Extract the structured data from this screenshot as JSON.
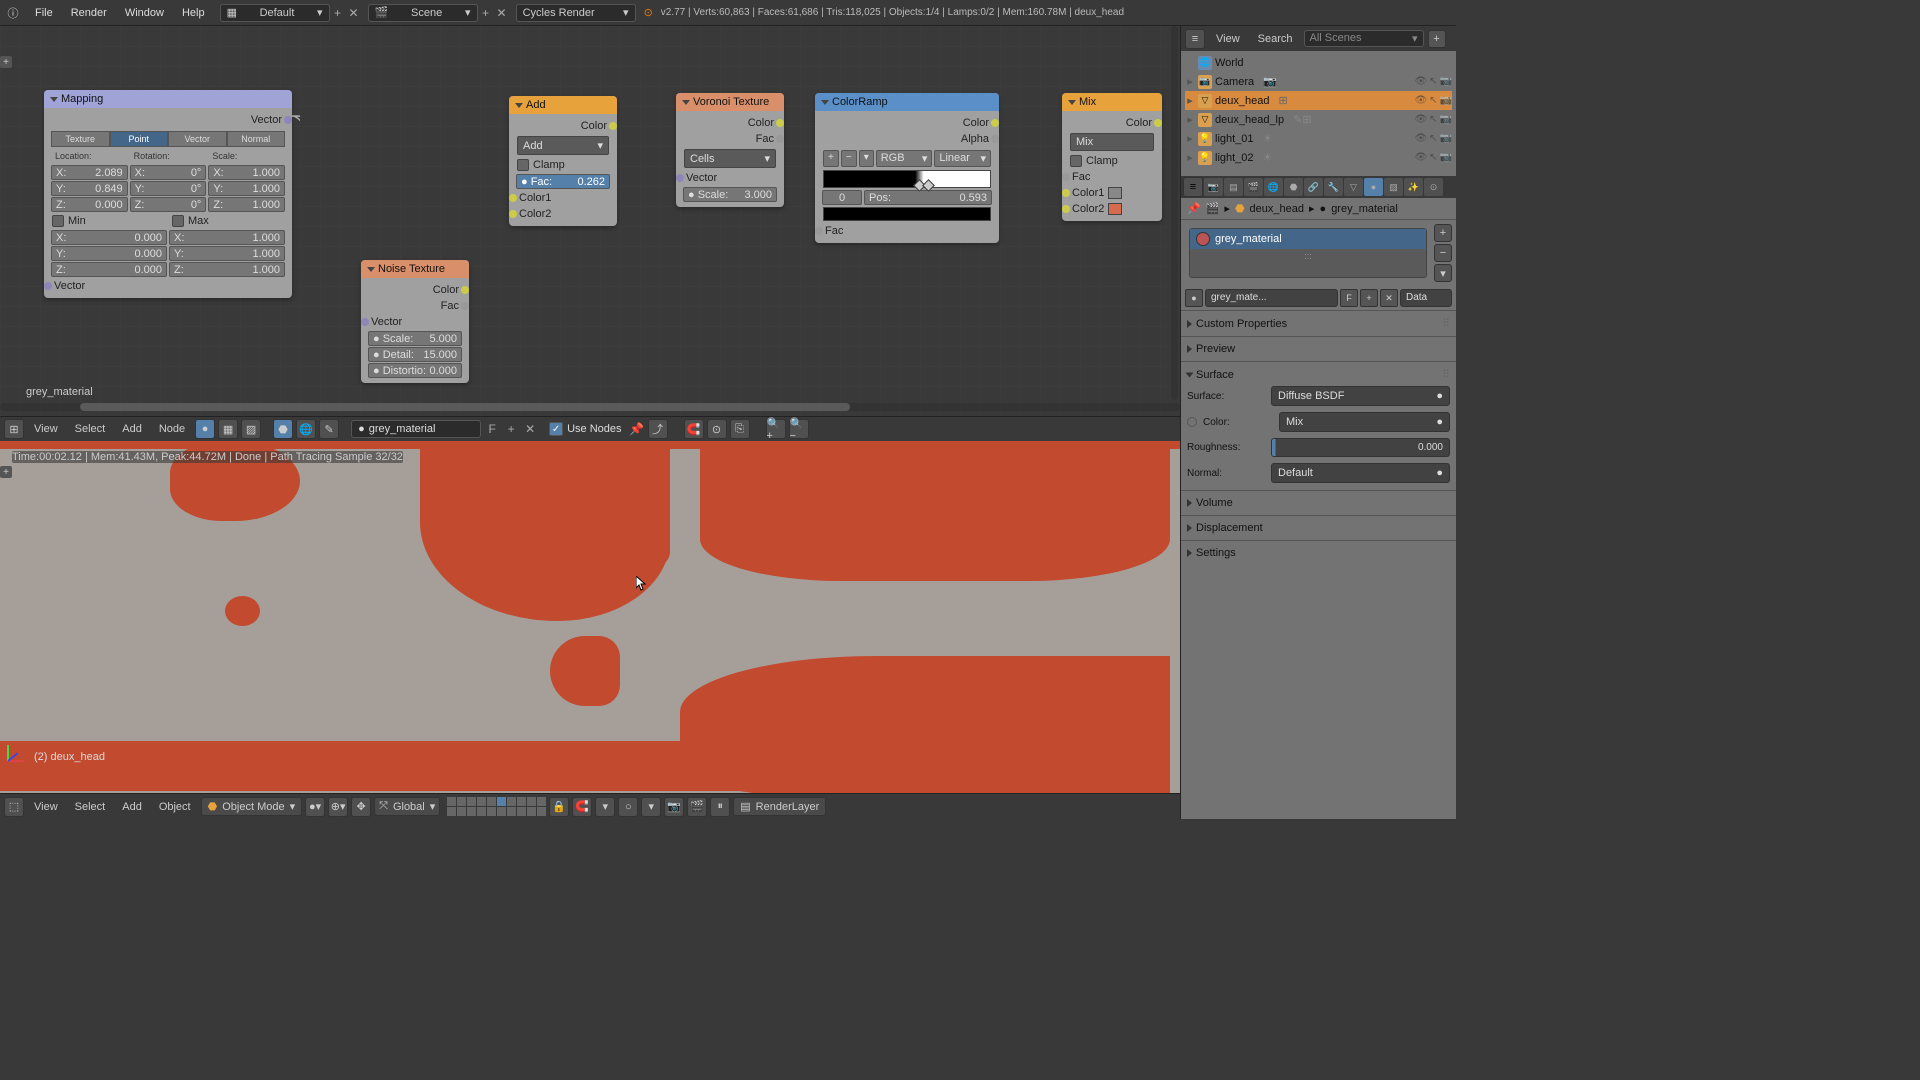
{
  "top": {
    "menus": [
      "File",
      "Render",
      "Window",
      "Help"
    ],
    "layout": "Default",
    "scene": "Scene",
    "engine": "Cycles Render",
    "stats": "v2.77 | Verts:60,863 | Faces:61,686 | Tris:118,025 | Objects:1/4 | Lamps:0/2 | Mem:160.78M | deux_head"
  },
  "node_editor": {
    "material_label": "grey_material",
    "menus": [
      "View",
      "Select",
      "Add",
      "Node"
    ],
    "material_name": "grey_material",
    "use_nodes": "Use Nodes"
  },
  "nodes": {
    "mapping": {
      "title": "Mapping",
      "vector_out": "Vector",
      "tabs": [
        "Texture",
        "Point",
        "Vector",
        "Normal"
      ],
      "loc_lbl": "Location:",
      "rot_lbl": "Rotation:",
      "scl_lbl": "Scale:",
      "loc": [
        "X:",
        "2.089",
        "Y:",
        "0.849",
        "Z:",
        "0.000"
      ],
      "rot": [
        "X:",
        "0°",
        "Y:",
        "0°",
        "Z:",
        "0°"
      ],
      "scl": [
        "X:",
        "1.000",
        "Y:",
        "1.000",
        "Z:",
        "1.000"
      ],
      "min": "Min",
      "max": "Max",
      "min_v": [
        "X:",
        "0.000",
        "Y:",
        "0.000",
        "Z:",
        "0.000"
      ],
      "max_v": [
        "X:",
        "1.000",
        "Y:",
        "1.000",
        "Z:",
        "1.000"
      ],
      "vector_in": "Vector"
    },
    "noise": {
      "title": "Noise Texture",
      "color": "Color",
      "fac": "Fac",
      "vector": "Vector",
      "scale_l": "Scale:",
      "scale_v": "5.000",
      "detail_l": "Detail:",
      "detail_v": "15.000",
      "dist_l": "Distortio:",
      "dist_v": "0.000"
    },
    "add": {
      "title": "Add",
      "color": "Color",
      "op": "Add",
      "clamp": "Clamp",
      "fac_l": "Fac:",
      "fac_v": "0.262",
      "c1": "Color1",
      "c2": "Color2"
    },
    "voronoi": {
      "title": "Voronoi Texture",
      "color": "Color",
      "fac": "Fac",
      "mode": "Cells",
      "vector": "Vector",
      "scale_l": "Scale:",
      "scale_v": "3.000"
    },
    "ramp": {
      "title": "ColorRamp",
      "color": "Color",
      "alpha": "Alpha",
      "rgb": "RGB",
      "linear": "Linear",
      "idx": "0",
      "pos_l": "Pos:",
      "pos_v": "0.593",
      "fac": "Fac"
    },
    "mix": {
      "title": "Mix",
      "color": "Color",
      "op": "Mix",
      "clamp": "Clamp",
      "fac": "Fac",
      "c1": "Color1",
      "c2": "Color2"
    }
  },
  "viewport": {
    "status": "Time:00:02.12 | Mem:41.43M, Peak:44.72M | Done | Path Tracing Sample 32/32",
    "object": "(2) deux_head",
    "menus": [
      "View",
      "Select",
      "Add",
      "Object"
    ],
    "mode": "Object Mode",
    "orient": "Global",
    "layer": "RenderLayer"
  },
  "outliner": {
    "view": "View",
    "search": "Search",
    "filter": "All Scenes",
    "items": [
      {
        "name": "World",
        "type": "world"
      },
      {
        "name": "Camera",
        "type": "cam"
      },
      {
        "name": "deux_head",
        "type": "mesh",
        "sel": true
      },
      {
        "name": "deux_head_lp",
        "type": "mesh"
      },
      {
        "name": "light_01",
        "type": "light"
      },
      {
        "name": "light_02",
        "type": "light"
      }
    ]
  },
  "breadcrumbs": {
    "obj": "deux_head",
    "mat": "grey_material"
  },
  "mat": {
    "name": "grey_material",
    "name2": "grey_mate...",
    "F": "F",
    "data": "Data",
    "custom": "Custom Properties",
    "preview": "Preview",
    "surface": "Surface",
    "volume": "Volume",
    "disp": "Displacement",
    "settings": "Settings",
    "surface_v": "Diffuse BSDF",
    "color_l": "Color:",
    "color_v": "Mix",
    "rough_l": "Roughness:",
    "rough_v": "0.000",
    "normal_l": "Normal:",
    "normal_v": "Default",
    "surf_l": "Surface:"
  }
}
